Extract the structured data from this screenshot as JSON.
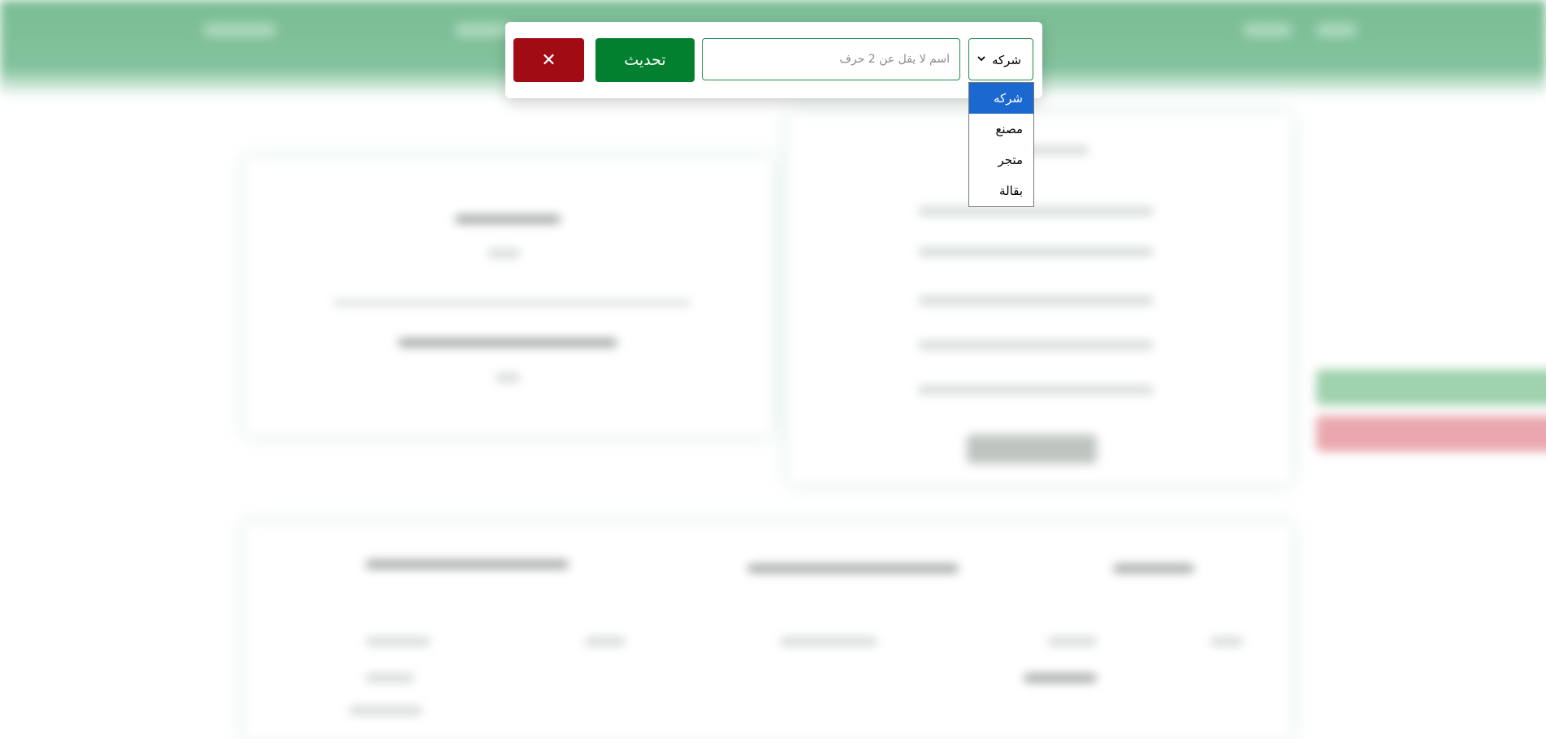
{
  "search": {
    "close_label": "✕",
    "update_label": "تحديث",
    "name_placeholder": "اسم لا يقل عن 2 حرف",
    "name_value": "",
    "type_selected": "شركه",
    "type_options": [
      "شركه",
      "مصنع",
      "متجر",
      "بقالة"
    ]
  },
  "colors": {
    "close_button": "#a00b14",
    "update_button": "#028030",
    "selected_option": "#1b69d0",
    "header_background": "#7bbd95"
  },
  "icons": {
    "close": "close-icon",
    "dropdown": "chevron-down-icon"
  }
}
